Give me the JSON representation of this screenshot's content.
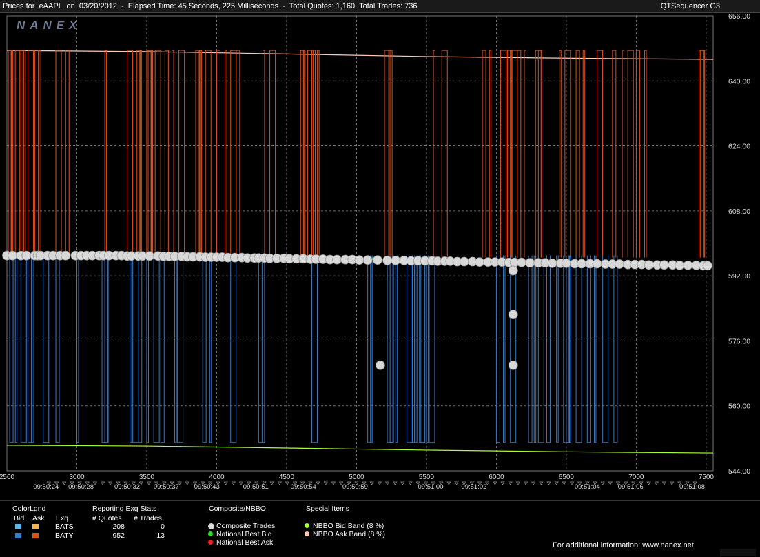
{
  "window": {
    "title": "Prices for  eAAPL  on  03/20/2012  -  Elapsed Time: 45 Seconds, 225 Milliseconds  -  Total Quotes: 1,160  Total Trades: 736",
    "app_name": "QTSequencer G3"
  },
  "logo": "NANEX",
  "chart_data": {
    "type": "line",
    "title": "",
    "y_axis_side": "right",
    "ylim": [
      544,
      656
    ],
    "y_ticks": [
      "544.00",
      "560.00",
      "576.00",
      "592.00",
      "608.00",
      "624.00",
      "640.00",
      "656.00"
    ],
    "xlim": [
      2500,
      7550
    ],
    "x_ticks": [
      "2500",
      "3000",
      "3500",
      "4000",
      "4500",
      "5000",
      "5500",
      "6000",
      "6500",
      "7000",
      "7500"
    ],
    "time_labels": [
      {
        "x": 2780,
        "label": "09:50:24"
      },
      {
        "x": 3030,
        "label": "09:50:28"
      },
      {
        "x": 3360,
        "label": "09:50:32"
      },
      {
        "x": 3640,
        "label": "09:50:37"
      },
      {
        "x": 3930,
        "label": "09:50:43"
      },
      {
        "x": 4280,
        "label": "09:50:51"
      },
      {
        "x": 4620,
        "label": "09:50:54"
      },
      {
        "x": 4990,
        "label": "09:50:59"
      },
      {
        "x": 5530,
        "label": "09:51:00"
      },
      {
        "x": 5840,
        "label": "09:51:02"
      },
      {
        "x": 6650,
        "label": "09:51:04"
      },
      {
        "x": 6960,
        "label": "09:51:06"
      },
      {
        "x": 7400,
        "label": "09:51:08"
      }
    ],
    "grid": true,
    "series": [
      {
        "name": "NBBO Ask Band (8 %)",
        "color": "#ffc8b4",
        "x": [
          2500,
          3500,
          4500,
          5500,
          6500,
          7550
        ],
        "values": [
          647.5,
          647.2,
          646.6,
          646.0,
          645.6,
          645.3
        ]
      },
      {
        "name": "NBBO Bid Band (8 %)",
        "color": "#aaff33",
        "x": [
          2500,
          3500,
          4500,
          5500,
          6500,
          7550
        ],
        "values": [
          550.3,
          550.1,
          549.6,
          549.1,
          548.7,
          548.4
        ]
      },
      {
        "name": "BATY",
        "role": "ask",
        "color": "#e0501e",
        "base": 596.5,
        "top": 647.5,
        "spike_x": [
          2510,
          2530,
          2560,
          2590,
          2620,
          2650,
          2700,
          2730,
          2850,
          2920,
          3200,
          3360,
          3430,
          3450,
          3500,
          3510,
          3530,
          3560,
          3630,
          3680,
          3730,
          3850,
          3880,
          3920,
          4000,
          4060,
          4100,
          4140,
          4330,
          4380,
          4600,
          4620,
          4650,
          4680,
          4720,
          5200,
          5230,
          5550,
          5610,
          5900,
          5950,
          6030,
          6080,
          6100,
          6110,
          6150,
          6200,
          6280,
          6300,
          6450,
          6490,
          6570,
          6620,
          6720,
          6830,
          6900,
          6940,
          7000,
          7060,
          7450,
          7460
        ]
      },
      {
        "name": "BATY",
        "role": "bid",
        "color": "#3c78c3",
        "base": 597.0,
        "bottom": 551.0,
        "spike_x": [
          2520,
          2560,
          2600,
          2650,
          2680,
          2760,
          2850,
          3000,
          3180,
          3200,
          3380,
          3400,
          3440,
          3500,
          3550,
          3600,
          3700,
          3720,
          3900,
          3950,
          4100,
          4300,
          4330,
          4680,
          5080,
          5100,
          5220,
          5240,
          5280,
          5360,
          5390,
          5420,
          5450,
          5460,
          5500,
          5520,
          6000,
          6050,
          6100,
          6230,
          6270,
          6300,
          6360,
          6430,
          6480,
          6500,
          6520,
          6570,
          6650,
          6700,
          6760,
          6840
        ]
      },
      {
        "name": "National Best Bid",
        "color": "#22dd22",
        "x": [
          2500,
          2600,
          2650,
          3380,
          3470,
          3600,
          5010,
          5150,
          6200
        ],
        "values": [
          597.0,
          597.0,
          597.0,
          597.0,
          597.0,
          596.9,
          596.1,
          596.2,
          595.8
        ]
      }
    ],
    "trades": {
      "name": "Composite Trades",
      "color": "#d8d8d8",
      "x": [
        2500,
        2540,
        2600,
        2640,
        2700,
        2720,
        2740,
        2790,
        2830,
        2880,
        2920,
        2990,
        3030,
        3070,
        3110,
        3160,
        3190,
        3230,
        3280,
        3320,
        3360,
        3390,
        3440,
        3470,
        3520,
        3580,
        3620,
        3660,
        3700,
        3750,
        3790,
        3830,
        3880,
        3920,
        3960,
        4000,
        4040,
        4080,
        4130,
        4180,
        4220,
        4270,
        4300,
        4340,
        4380,
        4430,
        4480,
        4520,
        4570,
        4620,
        4670,
        4710,
        4760,
        4810,
        4860,
        4920,
        4970,
        5020,
        5080,
        5150,
        5220,
        5280,
        5340,
        5390,
        5440,
        5490,
        5540,
        5580,
        5630,
        5670,
        5720,
        5770,
        5830,
        5880,
        5940,
        5990,
        6040,
        6090,
        6130,
        6180,
        6240,
        6300,
        6350,
        6400,
        6460,
        6500,
        6560,
        6610,
        6670,
        6720,
        6780,
        6830,
        6880,
        6940,
        6990,
        7040,
        7090,
        7150,
        7200,
        7260,
        7310,
        7370,
        7430,
        7480,
        7510,
        5170,
        6120,
        6120,
        6120
      ],
      "values": [
        597.0,
        597.0,
        597.0,
        597.0,
        597.0,
        597.0,
        597.0,
        597.0,
        597.0,
        597.0,
        597.0,
        597.0,
        597.0,
        597.0,
        597.0,
        597.0,
        597.0,
        597.0,
        597.0,
        597.0,
        596.9,
        596.9,
        596.9,
        596.9,
        596.9,
        596.9,
        596.8,
        596.8,
        596.8,
        596.8,
        596.7,
        596.7,
        596.7,
        596.6,
        596.6,
        596.6,
        596.6,
        596.5,
        596.5,
        596.5,
        596.4,
        596.4,
        596.4,
        596.4,
        596.3,
        596.3,
        596.3,
        596.2,
        596.2,
        596.2,
        596.1,
        596.1,
        596.1,
        596.0,
        596.0,
        596.0,
        596.0,
        595.9,
        595.9,
        595.9,
        595.8,
        595.8,
        595.8,
        595.7,
        595.7,
        595.7,
        595.7,
        595.6,
        595.6,
        595.6,
        595.5,
        595.5,
        595.5,
        595.4,
        595.4,
        595.4,
        595.4,
        595.3,
        595.3,
        595.3,
        595.2,
        595.2,
        595.2,
        595.1,
        595.1,
        595.1,
        595.0,
        595.0,
        595.0,
        595.0,
        594.9,
        594.9,
        594.9,
        594.8,
        594.8,
        594.8,
        594.7,
        594.7,
        594.7,
        594.7,
        594.6,
        594.6,
        594.6,
        594.5,
        594.5,
        570.0,
        593.3,
        582.5,
        570.0
      ]
    }
  },
  "legend": {
    "colorlegend": {
      "title": "ColorLgnd",
      "bid_header": "Bid",
      "ask_header": "Ask",
      "exq_header": "Exq",
      "rows": [
        {
          "name": "BATS",
          "bid_color": "#5fb4e6",
          "ask_color": "#f0b450"
        },
        {
          "name": "BATY",
          "bid_color": "#3c78c3",
          "ask_color": "#e0501e"
        }
      ]
    },
    "stats": {
      "title": "Reporting Exg Stats",
      "quotes_header": "# Quotes",
      "trades_header": "# Trades",
      "rows": [
        {
          "quotes": "208",
          "trades": "0"
        },
        {
          "quotes": "952",
          "trades": "13"
        }
      ]
    },
    "composite": {
      "title": "Composite/NBBO",
      "items": [
        {
          "label": "Composite Trades",
          "color": "#d8d8d8"
        },
        {
          "label": "National Best Bid",
          "color": "#22dd22"
        },
        {
          "label": "National Best Ask",
          "color": "#ee2222"
        }
      ]
    },
    "special": {
      "title": "Special Items",
      "items": [
        {
          "label": "NBBO Bid Band (8 %)",
          "color": "#aaff33"
        },
        {
          "label": "NBBO Ask Band (8 %)",
          "color": "#ffc8b4"
        }
      ]
    },
    "footer": "For additional information: www.nanex.net"
  }
}
